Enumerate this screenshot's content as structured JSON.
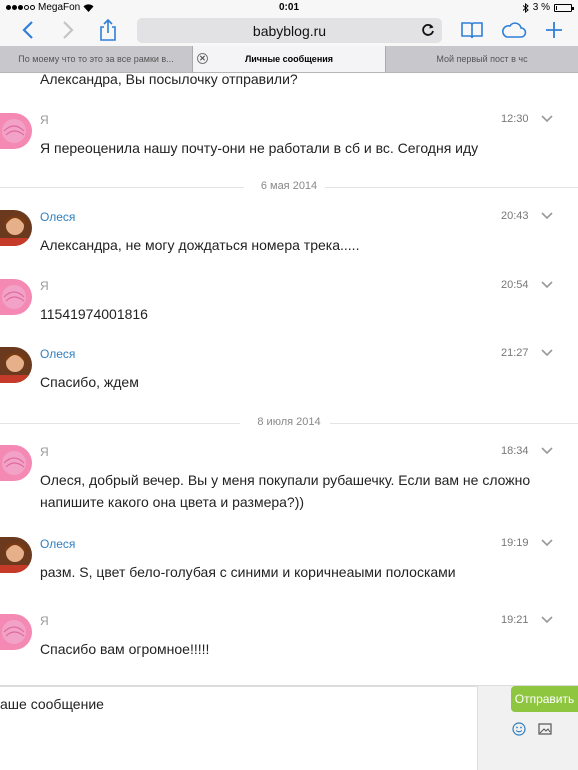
{
  "status_bar": {
    "carrier": "MegaFon",
    "time": "0:01",
    "battery": "3 %",
    "battery_level": 0.03
  },
  "browser": {
    "url": "babyblog.ru",
    "tabs": [
      {
        "label": "По моему что то это за все рамки в...",
        "active": false
      },
      {
        "label": "Личные сообщения",
        "active": true
      },
      {
        "label": "Мой первый пост в чс",
        "active": false
      }
    ]
  },
  "feed": {
    "partial_top_text": "Александра, Вы посылочку отправили?",
    "messages": [
      {
        "author": "Я",
        "time": "12:30",
        "text": "Я переоценила нашу почту-они не работали в сб и вс. Сегодня иду"
      },
      {
        "author": "Олеся",
        "time": "20:43",
        "text": "Александра, не могу дождаться номера трека....."
      },
      {
        "author": "Я",
        "time": "20:54",
        "text": "11541974001816"
      },
      {
        "author": "Олеся",
        "time": "21:27",
        "text": "Спасибо, ждем"
      },
      {
        "author": "Я",
        "time": "18:34",
        "text": "Олеся, добрый вечер. Вы у меня покупали рубашечку. Если вам не сложно напишите какого она цвета и размера?))"
      },
      {
        "author": "Олеся",
        "time": "19:19",
        "text": "разм. S, цвет бело-голубая с синими и коричнеаыми полосками"
      },
      {
        "author": "Я",
        "time": "19:21",
        "text": "Спасибо вам огромное!!!!!"
      }
    ],
    "separators": [
      {
        "label": "6 мая 2014"
      },
      {
        "label": "8 июля 2014"
      }
    ]
  },
  "compose": {
    "text": "аше сообщение",
    "send_label": "Отправить"
  },
  "colors": {
    "link_name": "#2f7fbf",
    "send_button": "#8ec63f",
    "toolbar_blue": "#2f7fd9"
  }
}
